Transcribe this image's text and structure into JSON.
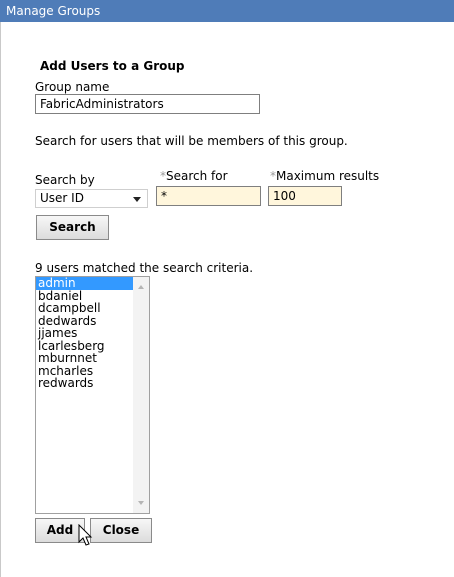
{
  "window": {
    "title": "Manage Groups"
  },
  "form": {
    "section_title": "Add Users to a Group",
    "group_name_label": "Group name",
    "group_name_value": "FabricAdministrators",
    "instructions": "Search for users that will be members of this group.",
    "search_by_label": "Search by",
    "search_by_value": "User ID",
    "required_marker": "*",
    "search_for_label": "Search for",
    "search_for_value": "*",
    "max_results_label": "Maximum results",
    "max_results_value": "100",
    "search_button": "Search"
  },
  "results": {
    "summary": "9 users matched the search criteria.",
    "users": [
      "admin",
      "bdaniel",
      "dcampbell",
      "dedwards",
      "jjames",
      "lcarlesberg",
      "mburnnet",
      "mcharles",
      "redwards"
    ],
    "selected": "admin"
  },
  "actions": {
    "add": "Add",
    "close": "Close"
  },
  "icons": {
    "cursor": "mouse-pointer-icon",
    "dropdown": "chevron-down-icon",
    "scroll_up": "scroll-up-arrow-icon",
    "scroll_down": "scroll-down-arrow-icon"
  },
  "colors": {
    "titlebar": "#4f7cb8",
    "required_bg": "#fff6dc",
    "selection": "#3399ff"
  }
}
